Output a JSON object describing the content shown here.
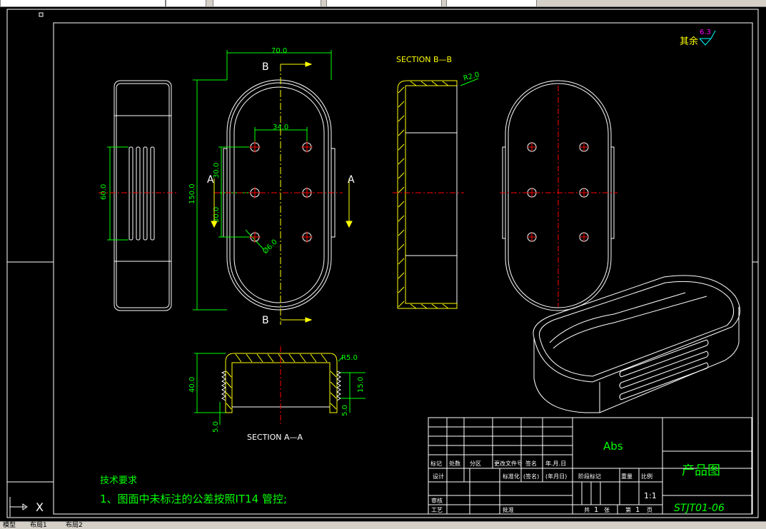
{
  "toolbar": {
    "items": [
      "",
      "",
      "",
      "",
      ""
    ]
  },
  "layout_tabs": {
    "model": "模型",
    "layout1": "布局1",
    "layout2": "布局2"
  },
  "drawing": {
    "roughness": {
      "prefix": "其余",
      "value": "6.3"
    },
    "labels": {
      "section_bb": "SECTION B—B",
      "section_aa": "SECTION A—A",
      "b_top": "B",
      "b_bottom": "B",
      "a_left": "A",
      "a_right": "A"
    },
    "dims": {
      "top_width": "70.0",
      "height_150": "150.0",
      "hole_spacing_34": "34.0",
      "hole_spacing_30a": "30.0",
      "hole_spacing_30b": "30.0",
      "hole_dia": "Ø6.0",
      "side_60": "60.0",
      "r2": "R2.0",
      "r5": "R5.0",
      "h40": "40.0",
      "h15": "15.0",
      "h5a": "5.0",
      "h5b": "5.0"
    },
    "notes": {
      "title": "技术要求",
      "line1": "1、图面中未标注的公差按照IT14 管控;"
    },
    "title_block": {
      "material": "Abs",
      "name": "产品图",
      "code": "STJT01-06",
      "scale": "1:1",
      "headers": [
        "标记",
        "处数",
        "分区",
        "更改文件号",
        "签名",
        "年.月.日"
      ],
      "row_design": [
        "设计",
        "",
        "",
        "标准化",
        "(签名)",
        "(年月日)"
      ],
      "stage_headers": [
        "阶段标记",
        "重量",
        "比例"
      ],
      "review": "审核",
      "process": "工艺",
      "approve": "批准",
      "total": "共",
      "total_num": "1",
      "sheet_unit": "张",
      "page": "第",
      "page_num": "1",
      "page_unit": "页"
    }
  },
  "colors": {
    "outline": "#ffffff",
    "dimension": "#00ff00",
    "center": "#ff0000",
    "section": "#ffff00",
    "cutline": "#ffff00",
    "holes": "#ff0000",
    "roughness_symbol": "#00ffff"
  }
}
